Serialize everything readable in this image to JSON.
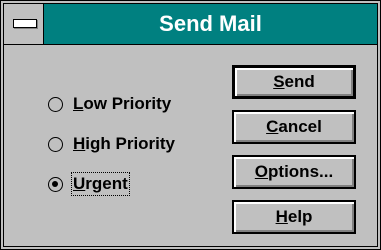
{
  "window": {
    "title": "Send Mail",
    "system_menu_icon": "system-menu-icon"
  },
  "priority": {
    "options": [
      {
        "mnemonic": "L",
        "rest": "ow Priority",
        "checked": false
      },
      {
        "mnemonic": "H",
        "rest": "igh Priority",
        "checked": false
      },
      {
        "mnemonic": "U",
        "rest": "rgent",
        "checked": true
      }
    ]
  },
  "buttons": {
    "send": {
      "mnemonic": "S",
      "rest": "end"
    },
    "cancel": {
      "mnemonic": "C",
      "rest": "ancel"
    },
    "options": {
      "mnemonic": "O",
      "rest": "ptions..."
    },
    "help": {
      "mnemonic": "H",
      "rest": "elp"
    }
  },
  "colors": {
    "title_bar": "#008080",
    "face": "#c0c0c0"
  }
}
